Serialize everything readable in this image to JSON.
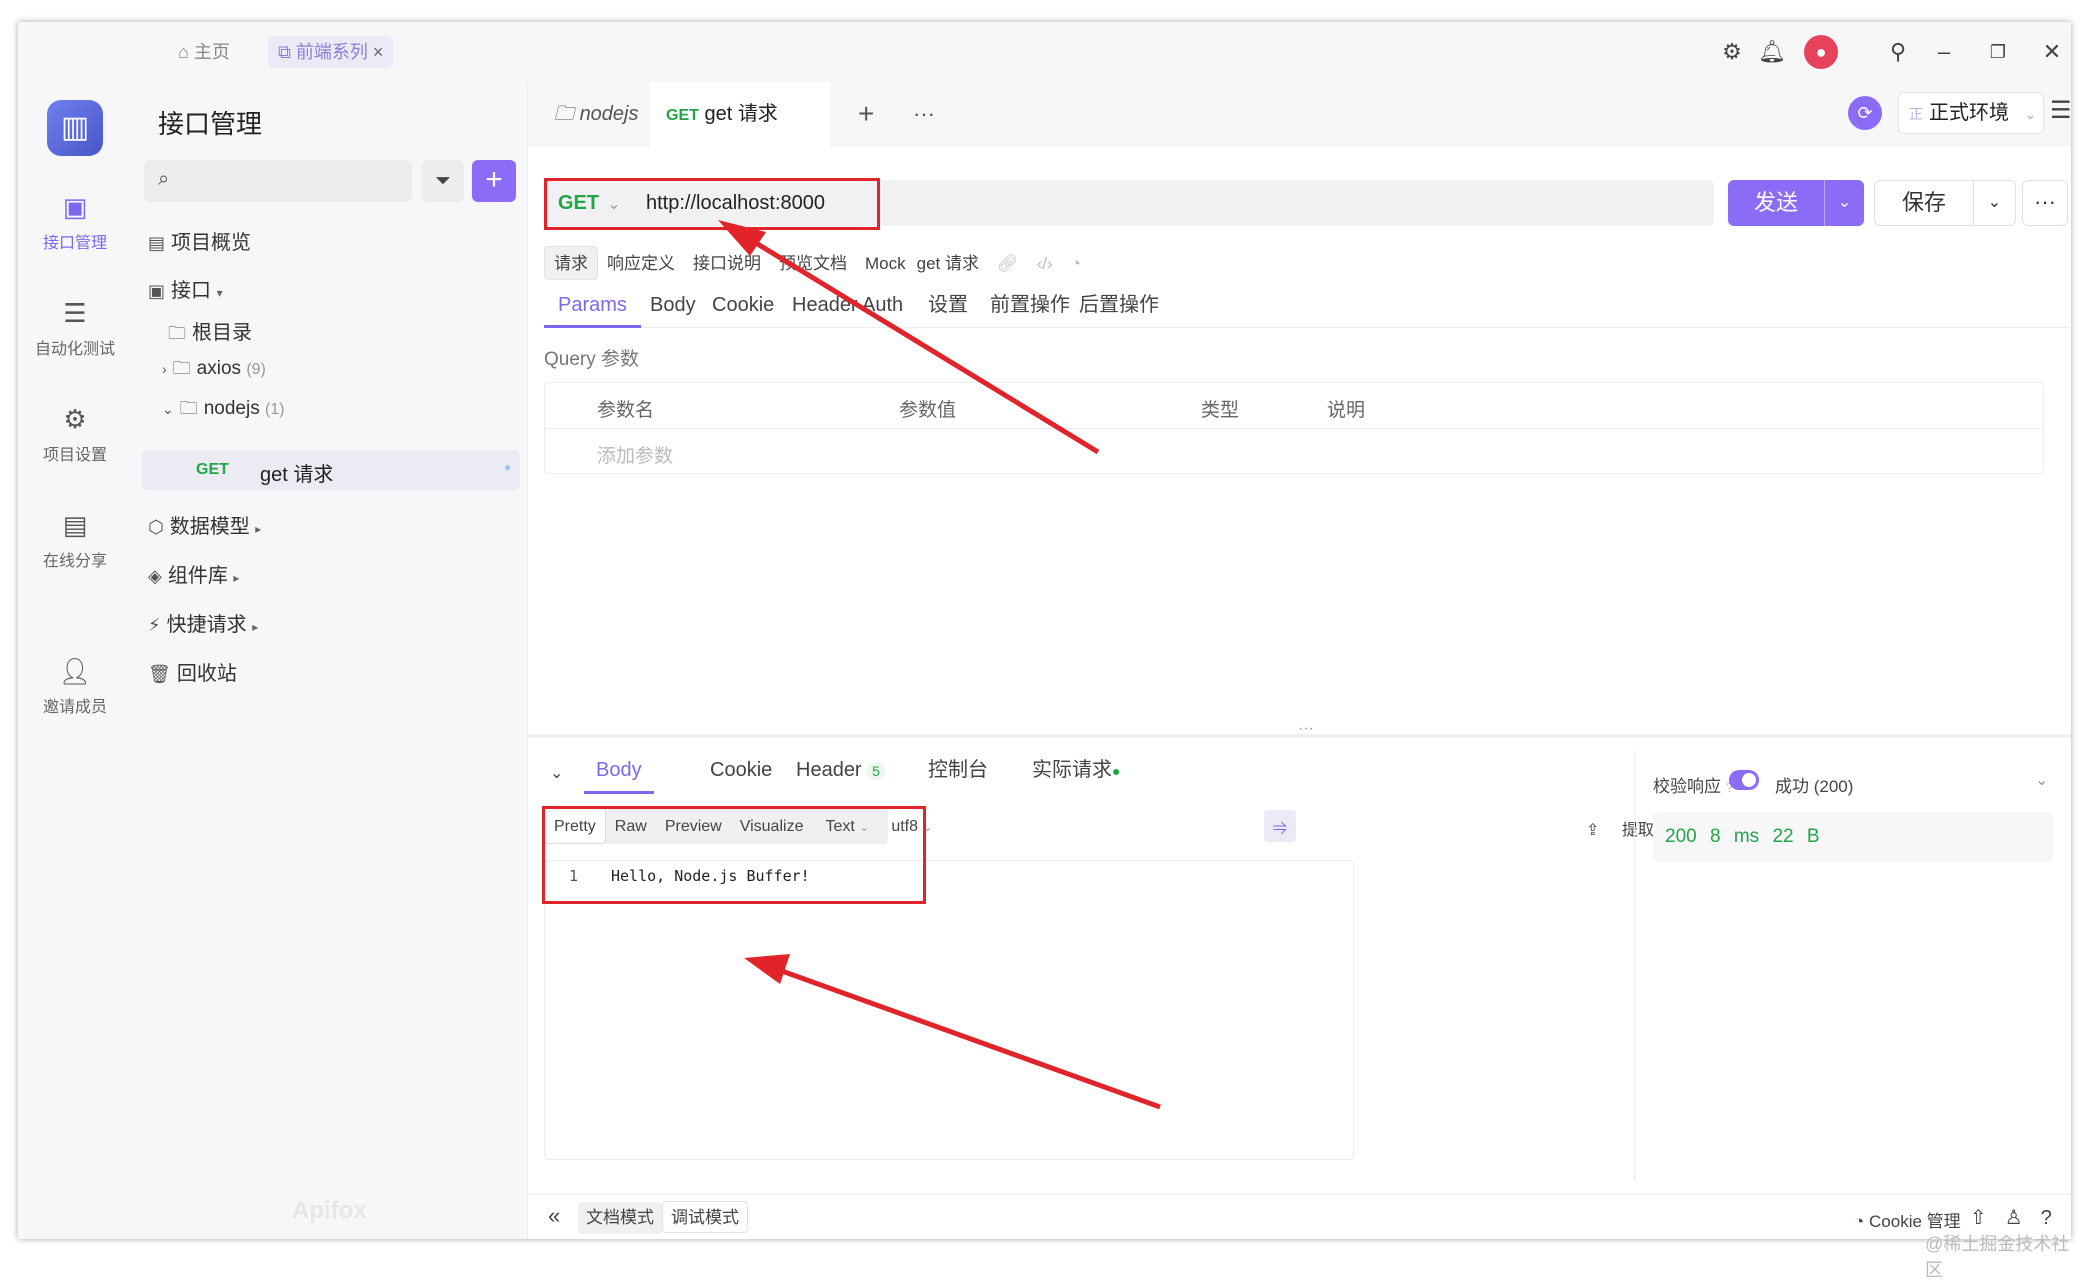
{
  "titlebar": {
    "home": "主页",
    "project_tab": "前端系列",
    "close": "×"
  },
  "rail": {
    "items": [
      {
        "label": "接口管理",
        "icon": "api-icon"
      },
      {
        "label": "自动化测试",
        "icon": "test-icon"
      },
      {
        "label": "项目设置",
        "icon": "settings-icon"
      },
      {
        "label": "在线分享",
        "icon": "share-icon"
      },
      {
        "label": "邀请成员",
        "icon": "invite-icon"
      }
    ]
  },
  "sidebar": {
    "title": "接口管理",
    "overview": "项目概览",
    "api": "接口",
    "root": "根目录",
    "folder1": "axios",
    "folder1_count": "(9)",
    "folder2": "nodejs",
    "folder2_count": "(1)",
    "req_method": "GET",
    "req_name": "get 请求",
    "models": "数据模型",
    "components": "组件库",
    "quick": "快捷请求",
    "trash": "回收站",
    "brand": "Apifox"
  },
  "tabs": {
    "folder": "nodejs",
    "method": "GET",
    "name": "get 请求",
    "plus": "+",
    "more": "···"
  },
  "env": {
    "badge": "正",
    "name": "正式环境"
  },
  "request": {
    "method": "GET",
    "url": "http://localhost:8000",
    "send": "发送",
    "save": "保存"
  },
  "subtabs": [
    "请求",
    "响应定义",
    "接口说明",
    "预览文档",
    "Mock",
    "get 请求"
  ],
  "param_tabs": [
    "Params",
    "Body",
    "Cookie",
    "Header",
    "Auth",
    "设置",
    "前置操作",
    "后置操作"
  ],
  "query": {
    "label": "Query 参数",
    "cols": [
      "参数名",
      "参数值",
      "类型",
      "说明"
    ],
    "add": "添加参数"
  },
  "response": {
    "tabs": [
      "Body",
      "Cookie",
      "Header",
      "控制台",
      "实际请求"
    ],
    "header_count": "5",
    "formats": [
      "Pretty",
      "Raw",
      "Preview",
      "Visualize",
      "Text",
      "utf8"
    ],
    "extract": "提取",
    "line_no": "1",
    "body": "Hello, Node.js Buffer!"
  },
  "validate": {
    "label": "校验响应",
    "status": "成功 (200)",
    "code": "200",
    "time": "8 ms",
    "size": "22 B"
  },
  "footer": {
    "doc_mode": "文档模式",
    "debug_mode": "调试模式",
    "cookie": "Cookie 管理"
  },
  "watermark": "@稀土掘金技术社区",
  "colors": {
    "accent": "#8b6cf6",
    "get": "#22a546",
    "highlight": "#e0242a"
  }
}
